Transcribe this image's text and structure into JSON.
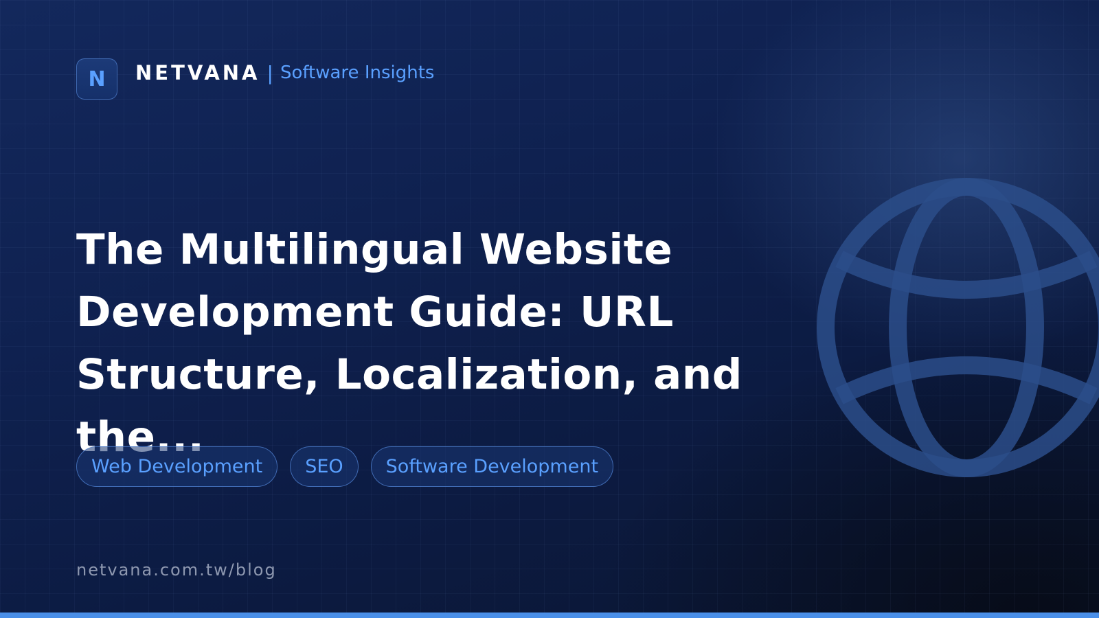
{
  "brand": {
    "logo_letter": "N",
    "name": "NETVANA",
    "separator": "|",
    "tagline": "Software Insights"
  },
  "headline": "The Multilingual Website Development Guide: URL Structure, Localization, and the...",
  "tags": [
    "Web Development",
    "SEO",
    "Software Development"
  ],
  "footer": {
    "url": "netvana.com.tw/blog"
  },
  "colors": {
    "background": "#0f2150",
    "accent": "#5aa0ff",
    "bottom_bar": "#4a8fe8",
    "url_text": "#8e98b0"
  },
  "icons": {
    "decorative_globe": "globe-icon"
  }
}
